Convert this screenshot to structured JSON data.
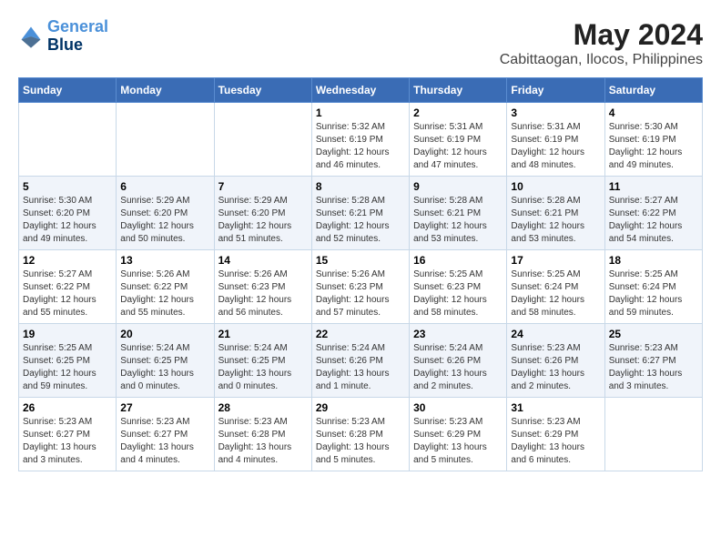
{
  "logo": {
    "line1": "General",
    "line2": "Blue"
  },
  "title": "May 2024",
  "subtitle": "Cabittaogan, Ilocos, Philippines",
  "days_header": [
    "Sunday",
    "Monday",
    "Tuesday",
    "Wednesday",
    "Thursday",
    "Friday",
    "Saturday"
  ],
  "weeks": [
    [
      {
        "day": "",
        "info": ""
      },
      {
        "day": "",
        "info": ""
      },
      {
        "day": "",
        "info": ""
      },
      {
        "day": "1",
        "info": "Sunrise: 5:32 AM\nSunset: 6:19 PM\nDaylight: 12 hours\nand 46 minutes."
      },
      {
        "day": "2",
        "info": "Sunrise: 5:31 AM\nSunset: 6:19 PM\nDaylight: 12 hours\nand 47 minutes."
      },
      {
        "day": "3",
        "info": "Sunrise: 5:31 AM\nSunset: 6:19 PM\nDaylight: 12 hours\nand 48 minutes."
      },
      {
        "day": "4",
        "info": "Sunrise: 5:30 AM\nSunset: 6:19 PM\nDaylight: 12 hours\nand 49 minutes."
      }
    ],
    [
      {
        "day": "5",
        "info": "Sunrise: 5:30 AM\nSunset: 6:20 PM\nDaylight: 12 hours\nand 49 minutes."
      },
      {
        "day": "6",
        "info": "Sunrise: 5:29 AM\nSunset: 6:20 PM\nDaylight: 12 hours\nand 50 minutes."
      },
      {
        "day": "7",
        "info": "Sunrise: 5:29 AM\nSunset: 6:20 PM\nDaylight: 12 hours\nand 51 minutes."
      },
      {
        "day": "8",
        "info": "Sunrise: 5:28 AM\nSunset: 6:21 PM\nDaylight: 12 hours\nand 52 minutes."
      },
      {
        "day": "9",
        "info": "Sunrise: 5:28 AM\nSunset: 6:21 PM\nDaylight: 12 hours\nand 53 minutes."
      },
      {
        "day": "10",
        "info": "Sunrise: 5:28 AM\nSunset: 6:21 PM\nDaylight: 12 hours\nand 53 minutes."
      },
      {
        "day": "11",
        "info": "Sunrise: 5:27 AM\nSunset: 6:22 PM\nDaylight: 12 hours\nand 54 minutes."
      }
    ],
    [
      {
        "day": "12",
        "info": "Sunrise: 5:27 AM\nSunset: 6:22 PM\nDaylight: 12 hours\nand 55 minutes."
      },
      {
        "day": "13",
        "info": "Sunrise: 5:26 AM\nSunset: 6:22 PM\nDaylight: 12 hours\nand 55 minutes."
      },
      {
        "day": "14",
        "info": "Sunrise: 5:26 AM\nSunset: 6:23 PM\nDaylight: 12 hours\nand 56 minutes."
      },
      {
        "day": "15",
        "info": "Sunrise: 5:26 AM\nSunset: 6:23 PM\nDaylight: 12 hours\nand 57 minutes."
      },
      {
        "day": "16",
        "info": "Sunrise: 5:25 AM\nSunset: 6:23 PM\nDaylight: 12 hours\nand 58 minutes."
      },
      {
        "day": "17",
        "info": "Sunrise: 5:25 AM\nSunset: 6:24 PM\nDaylight: 12 hours\nand 58 minutes."
      },
      {
        "day": "18",
        "info": "Sunrise: 5:25 AM\nSunset: 6:24 PM\nDaylight: 12 hours\nand 59 minutes."
      }
    ],
    [
      {
        "day": "19",
        "info": "Sunrise: 5:25 AM\nSunset: 6:25 PM\nDaylight: 12 hours\nand 59 minutes."
      },
      {
        "day": "20",
        "info": "Sunrise: 5:24 AM\nSunset: 6:25 PM\nDaylight: 13 hours\nand 0 minutes."
      },
      {
        "day": "21",
        "info": "Sunrise: 5:24 AM\nSunset: 6:25 PM\nDaylight: 13 hours\nand 0 minutes."
      },
      {
        "day": "22",
        "info": "Sunrise: 5:24 AM\nSunset: 6:26 PM\nDaylight: 13 hours\nand 1 minute."
      },
      {
        "day": "23",
        "info": "Sunrise: 5:24 AM\nSunset: 6:26 PM\nDaylight: 13 hours\nand 2 minutes."
      },
      {
        "day": "24",
        "info": "Sunrise: 5:23 AM\nSunset: 6:26 PM\nDaylight: 13 hours\nand 2 minutes."
      },
      {
        "day": "25",
        "info": "Sunrise: 5:23 AM\nSunset: 6:27 PM\nDaylight: 13 hours\nand 3 minutes."
      }
    ],
    [
      {
        "day": "26",
        "info": "Sunrise: 5:23 AM\nSunset: 6:27 PM\nDaylight: 13 hours\nand 3 minutes."
      },
      {
        "day": "27",
        "info": "Sunrise: 5:23 AM\nSunset: 6:27 PM\nDaylight: 13 hours\nand 4 minutes."
      },
      {
        "day": "28",
        "info": "Sunrise: 5:23 AM\nSunset: 6:28 PM\nDaylight: 13 hours\nand 4 minutes."
      },
      {
        "day": "29",
        "info": "Sunrise: 5:23 AM\nSunset: 6:28 PM\nDaylight: 13 hours\nand 5 minutes."
      },
      {
        "day": "30",
        "info": "Sunrise: 5:23 AM\nSunset: 6:29 PM\nDaylight: 13 hours\nand 5 minutes."
      },
      {
        "day": "31",
        "info": "Sunrise: 5:23 AM\nSunset: 6:29 PM\nDaylight: 13 hours\nand 6 minutes."
      },
      {
        "day": "",
        "info": ""
      }
    ]
  ]
}
